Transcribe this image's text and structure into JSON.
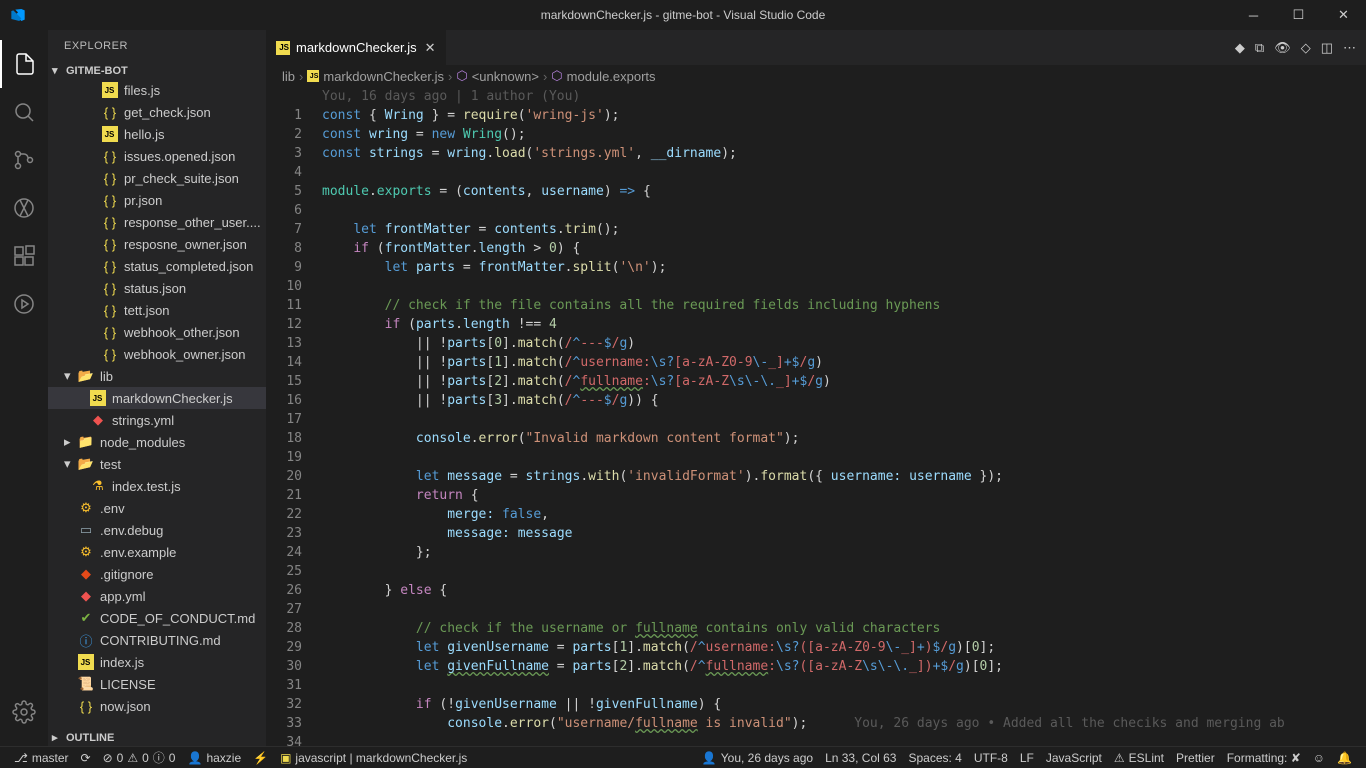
{
  "window": {
    "title": "markdownChecker.js - gitme-bot - Visual Studio Code"
  },
  "sidebar": {
    "title": "EXPLORER",
    "project": "GITME-BOT",
    "outline": "OUTLINE",
    "files": [
      {
        "depth": 3,
        "name": "files.js",
        "type": "js"
      },
      {
        "depth": 3,
        "name": "get_check.json",
        "type": "json"
      },
      {
        "depth": 3,
        "name": "hello.js",
        "type": "js"
      },
      {
        "depth": 3,
        "name": "issues.opened.json",
        "type": "json"
      },
      {
        "depth": 3,
        "name": "pr_check_suite.json",
        "type": "json"
      },
      {
        "depth": 3,
        "name": "pr.json",
        "type": "json"
      },
      {
        "depth": 3,
        "name": "response_other_user....",
        "type": "json"
      },
      {
        "depth": 3,
        "name": "resposne_owner.json",
        "type": "json"
      },
      {
        "depth": 3,
        "name": "status_completed.json",
        "type": "json"
      },
      {
        "depth": 3,
        "name": "status.json",
        "type": "json"
      },
      {
        "depth": 3,
        "name": "tett.json",
        "type": "json"
      },
      {
        "depth": 3,
        "name": "webhook_other.json",
        "type": "json"
      },
      {
        "depth": 3,
        "name": "webhook_owner.json",
        "type": "json"
      },
      {
        "depth": 1,
        "name": "lib",
        "type": "folder-open"
      },
      {
        "depth": 2,
        "name": "markdownChecker.js",
        "type": "js",
        "selected": true
      },
      {
        "depth": 2,
        "name": "strings.yml",
        "type": "yml"
      },
      {
        "depth": 1,
        "name": "node_modules",
        "type": "folder-closed-green"
      },
      {
        "depth": 1,
        "name": "test",
        "type": "folder-open-green"
      },
      {
        "depth": 2,
        "name": "index.test.js",
        "type": "test"
      },
      {
        "depth": 1,
        "name": ".env",
        "type": "env"
      },
      {
        "depth": 1,
        "name": ".env.debug",
        "type": "file"
      },
      {
        "depth": 1,
        "name": ".env.example",
        "type": "env"
      },
      {
        "depth": 1,
        "name": ".gitignore",
        "type": "git"
      },
      {
        "depth": 1,
        "name": "app.yml",
        "type": "yml"
      },
      {
        "depth": 1,
        "name": "CODE_OF_CONDUCT.md",
        "type": "conduct"
      },
      {
        "depth": 1,
        "name": "CONTRIBUTING.md",
        "type": "md"
      },
      {
        "depth": 1,
        "name": "index.js",
        "type": "js"
      },
      {
        "depth": 1,
        "name": "LICENSE",
        "type": "lic"
      },
      {
        "depth": 1,
        "name": "now.json",
        "type": "json"
      }
    ]
  },
  "tabs": {
    "active": "markdownChecker.js"
  },
  "breadcrumbs": {
    "parts": [
      "lib",
      "markdownChecker.js",
      "<unknown>",
      "module.exports"
    ]
  },
  "editor": {
    "blame_header": "You, 16 days ago | 1 author (You)",
    "inline_blame": "You, 26 days ago • Added all the checiks and merging ab",
    "lines": 34
  },
  "statusbar": {
    "branch": "master",
    "errors": "0",
    "warnings": "0",
    "info": "0",
    "author": "haxzie",
    "lang_left": "javascript | markdownChecker.js",
    "blame": "You, 26 days ago",
    "position": "Ln 33, Col 63",
    "spaces": "Spaces: 4",
    "encoding": "UTF-8",
    "eol": "LF",
    "language": "JavaScript",
    "eslint": "ESLint",
    "prettier": "Prettier",
    "formatting": "Formatting: ✘"
  }
}
